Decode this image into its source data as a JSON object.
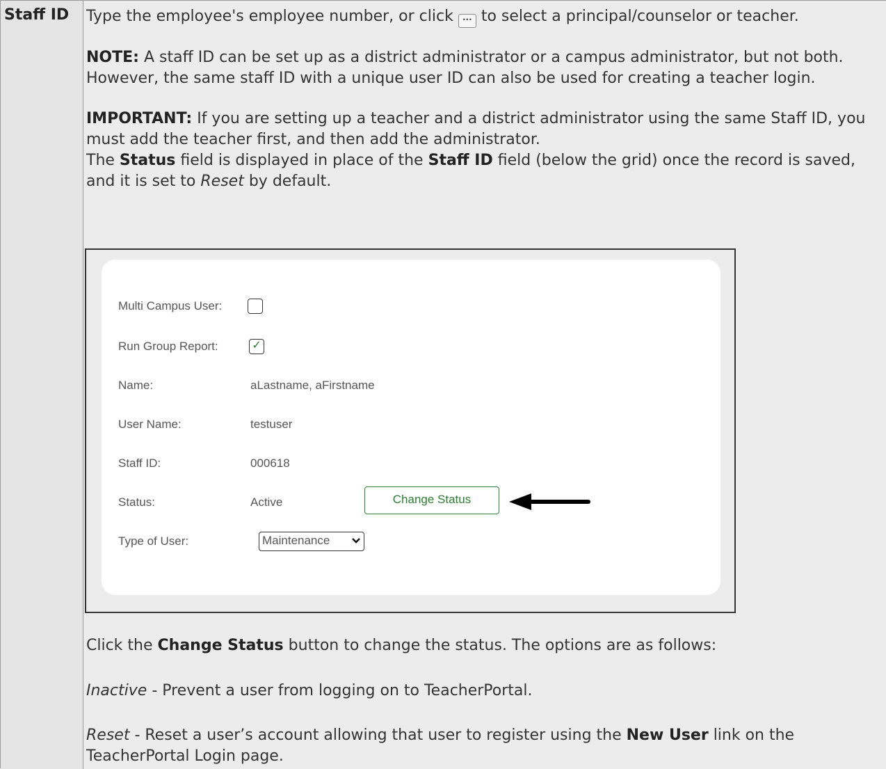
{
  "row_header": "Staff ID",
  "intro": {
    "before_icon": "Type the employee's employee number, or click",
    "icon": "ellipsis-icon",
    "after_icon": "to select a principal/counselor or teacher."
  },
  "note": {
    "label": "NOTE:",
    "text": "A staff ID can be set up as a district administrator or a campus administrator, but not both. However, the same staff ID with a unique user ID can also be used for creating a teacher login."
  },
  "important": {
    "label": "IMPORTANT:",
    "text": "If you are setting up a teacher and a district administrator using the same Staff ID, you must add the teacher first, and then add the administrator."
  },
  "status_para": {
    "t1": "The",
    "b1": "Status",
    "t2": "field is displayed in place of the",
    "b2": "Staff ID",
    "t3": "field (below the grid) once the record is saved, and it is set to",
    "i1": "Reset",
    "t4": "by default."
  },
  "screenshot": {
    "multi_campus_label": "Multi Campus User:",
    "multi_campus_checked": false,
    "run_group_label": "Run Group Report:",
    "run_group_checked": true,
    "name_label": "Name:",
    "name_value": "aLastname, aFirstname",
    "user_name_label": "User Name:",
    "user_name_value": "testuser",
    "staff_id_label": "Staff ID:",
    "staff_id_value": "000618",
    "status_label": "Status:",
    "status_value": "Active",
    "change_status_button": "Change Status",
    "type_label": "Type of User:",
    "type_value": "Maintenance",
    "accent_color": "#2e7d32"
  },
  "click_para": {
    "t1": "Click the",
    "b1": "Change Status",
    "t2": "button to change the status. The options are as follows:"
  },
  "inactive": {
    "term": "Inactive",
    "text": "- Prevent a user from logging on to TeacherPortal."
  },
  "reset": {
    "term": "Reset",
    "text1": "- Reset a user’s account allowing that user to register using the",
    "bold": "New User",
    "text2": "link on the TeacherPortal Login page."
  }
}
